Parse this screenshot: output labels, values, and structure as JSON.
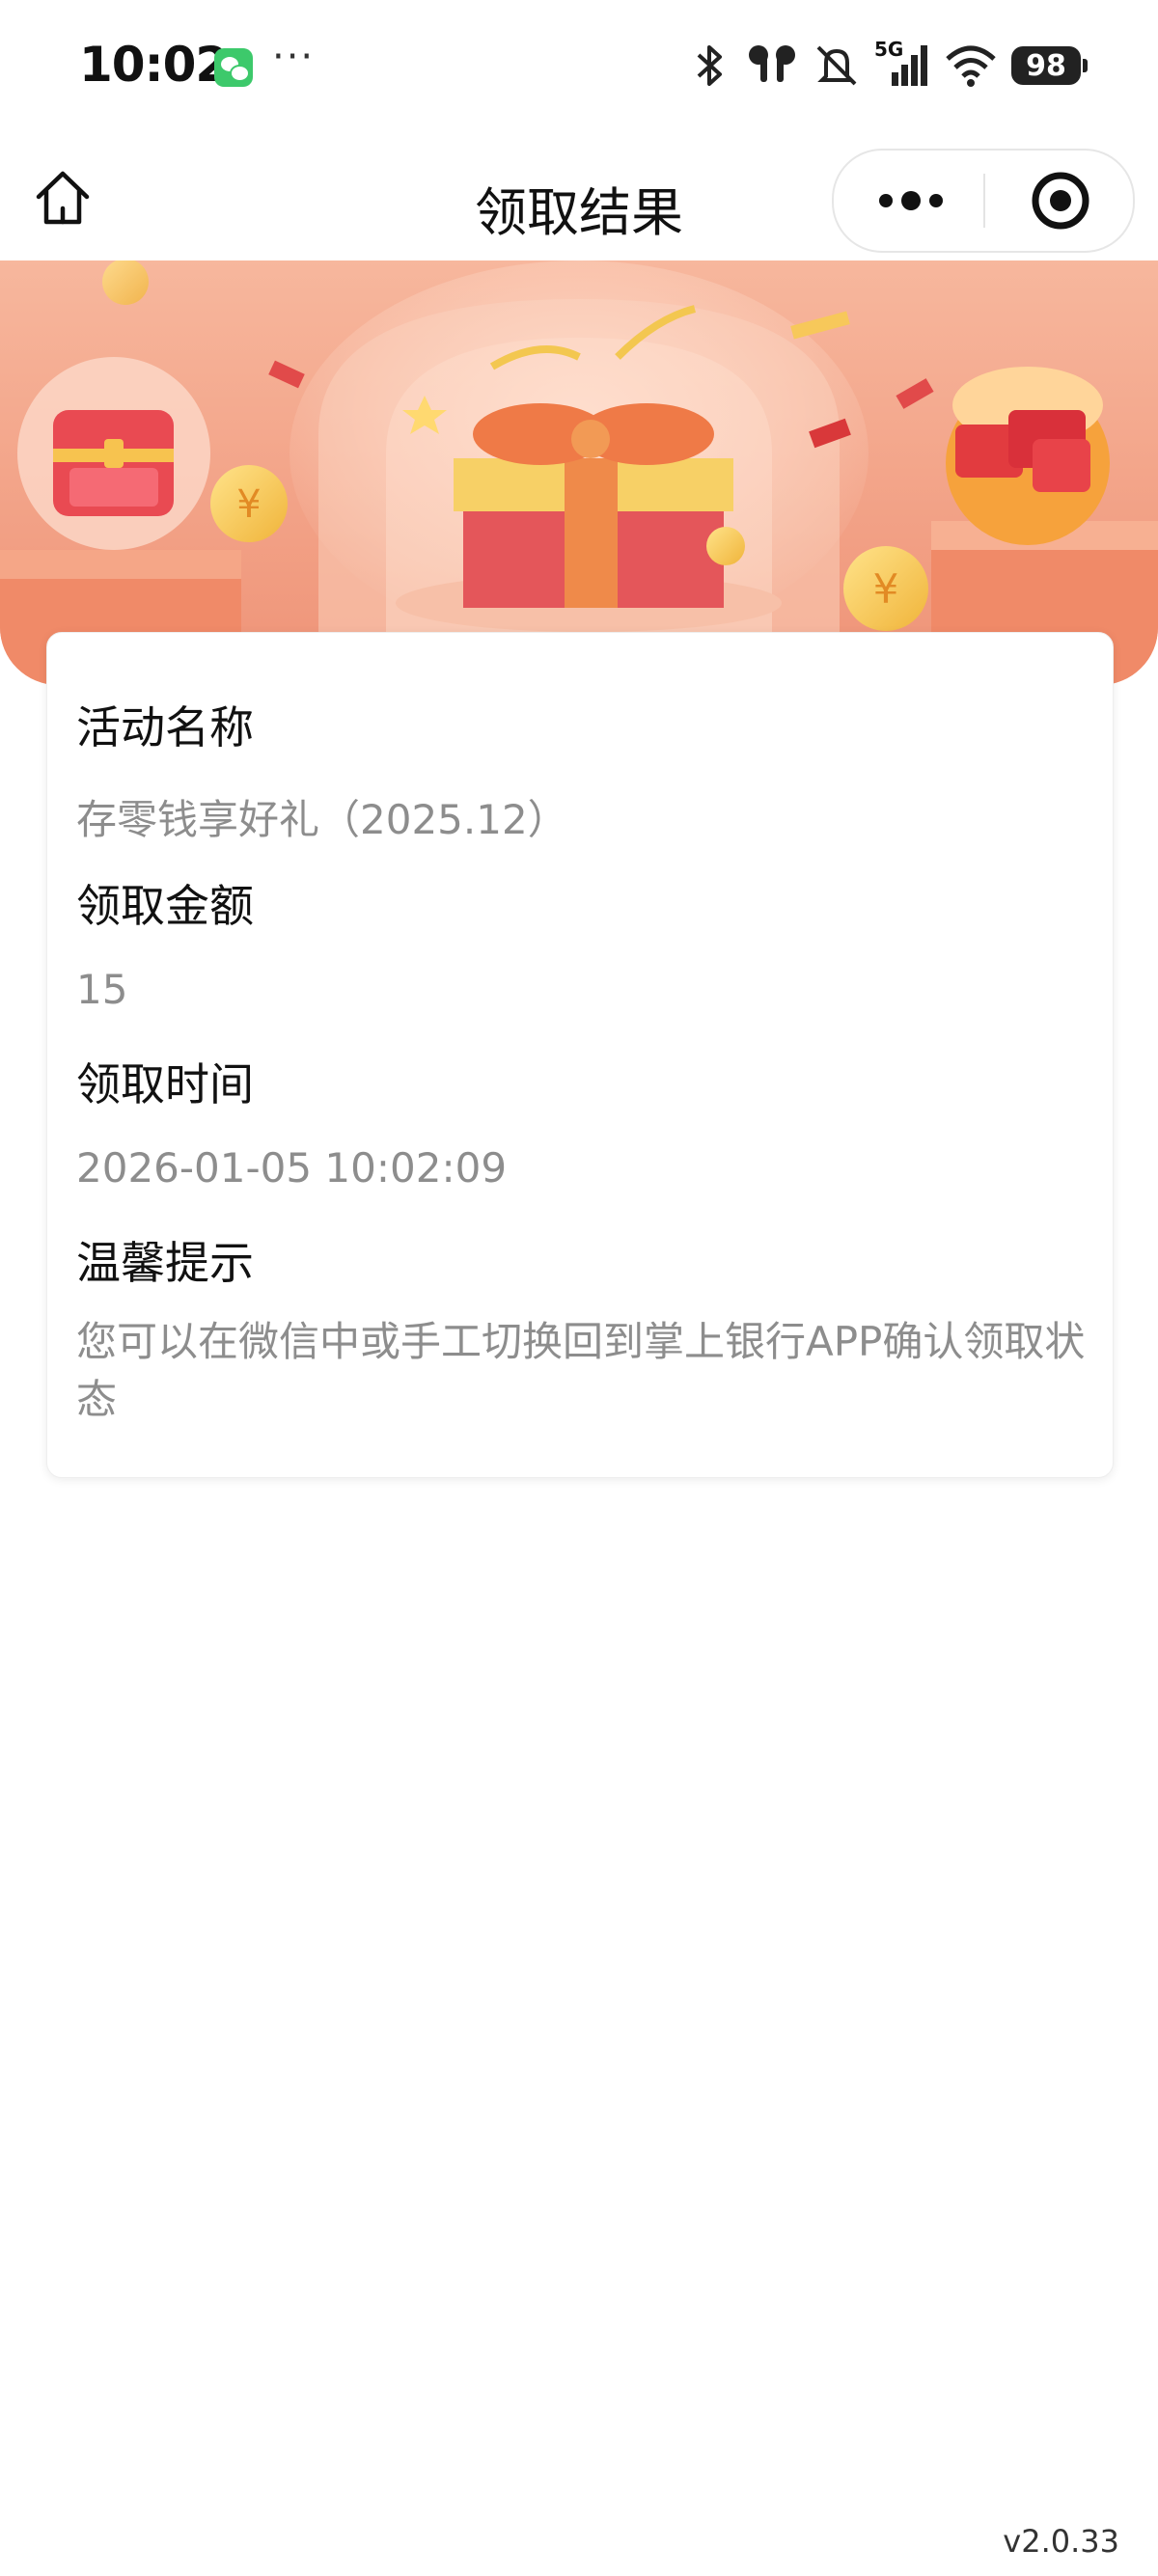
{
  "status_bar": {
    "time": "10:02",
    "more": "···",
    "network": "5G",
    "battery": "98"
  },
  "nav": {
    "title": "领取结果"
  },
  "card": {
    "activity_label": "活动名称",
    "activity_value": "存零钱享好礼（2025.12）",
    "amount_label": "领取金额",
    "amount_value": "15",
    "time_label": "领取时间",
    "time_value": "2026-01-05 10:02:09",
    "tip_label": "温馨提示",
    "tip_value": "您可以在微信中或手工切换回到掌上银行APP确认领取状态"
  },
  "footer": {
    "version": "v2.0.33"
  },
  "colors": {
    "banner_base": "#f3a98d",
    "value_text": "#8d8d8d"
  }
}
